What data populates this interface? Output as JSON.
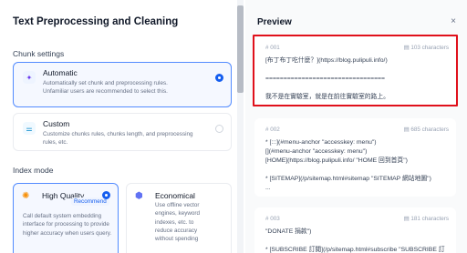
{
  "left": {
    "title": "Text Preprocessing and Cleaning",
    "chunk_settings_label": "Chunk settings",
    "automatic": {
      "title": "Automatic",
      "desc": "Automatically set chunk and preprocessing rules. Unfamiliar users are recommended to select this."
    },
    "custom": {
      "title": "Custom",
      "desc": "Customize chunks rules, chunks length, and preprocessing rules, etc."
    },
    "index_mode_label": "Index mode",
    "high_quality": {
      "title": "High Quality",
      "badge": "Recommend",
      "desc": "Call default system embedding interface for processing to provide higher accuracy when users query."
    },
    "economical": {
      "title": "Economical",
      "desc": "Use offline vector engines, keyword indexes, etc. to reduce accuracy without spending"
    }
  },
  "preview": {
    "title": "Preview",
    "close": "×",
    "chunks": [
      {
        "id": "# 001",
        "chars": "103 characters",
        "text": "[布丁布丁吃什麼？](https://blog.pulipuli.info/)\n\n=================================\n\n我不是在實驗室，就是在前往實驗室的路上。"
      },
      {
        "id": "# 002",
        "chars": "685 characters",
        "text": "* [:::](#menu-anchor \"accesskey: menu\")\n[](#menu-anchor \"accesskey: menu\")\n[HOME](https://blog.pulipuli.info/ \"HOME 回到首頁\")\n\n* [SITEMAP](/p/sitemap.html#sitemap \"SITEMAP 網站地圖\")\n..."
      },
      {
        "id": "# 003",
        "chars": "181 characters",
        "text": "\"DONATE 捐款\")\n\n* [SUBSCRIBE 訂閱](/p/sitemap.html#subscribe \"SUBSCRIBE 訂閱\")"
      }
    ]
  },
  "colors": {
    "accent": "#155eef",
    "selected_border": "#528bff",
    "highlight": "#e0101b"
  }
}
